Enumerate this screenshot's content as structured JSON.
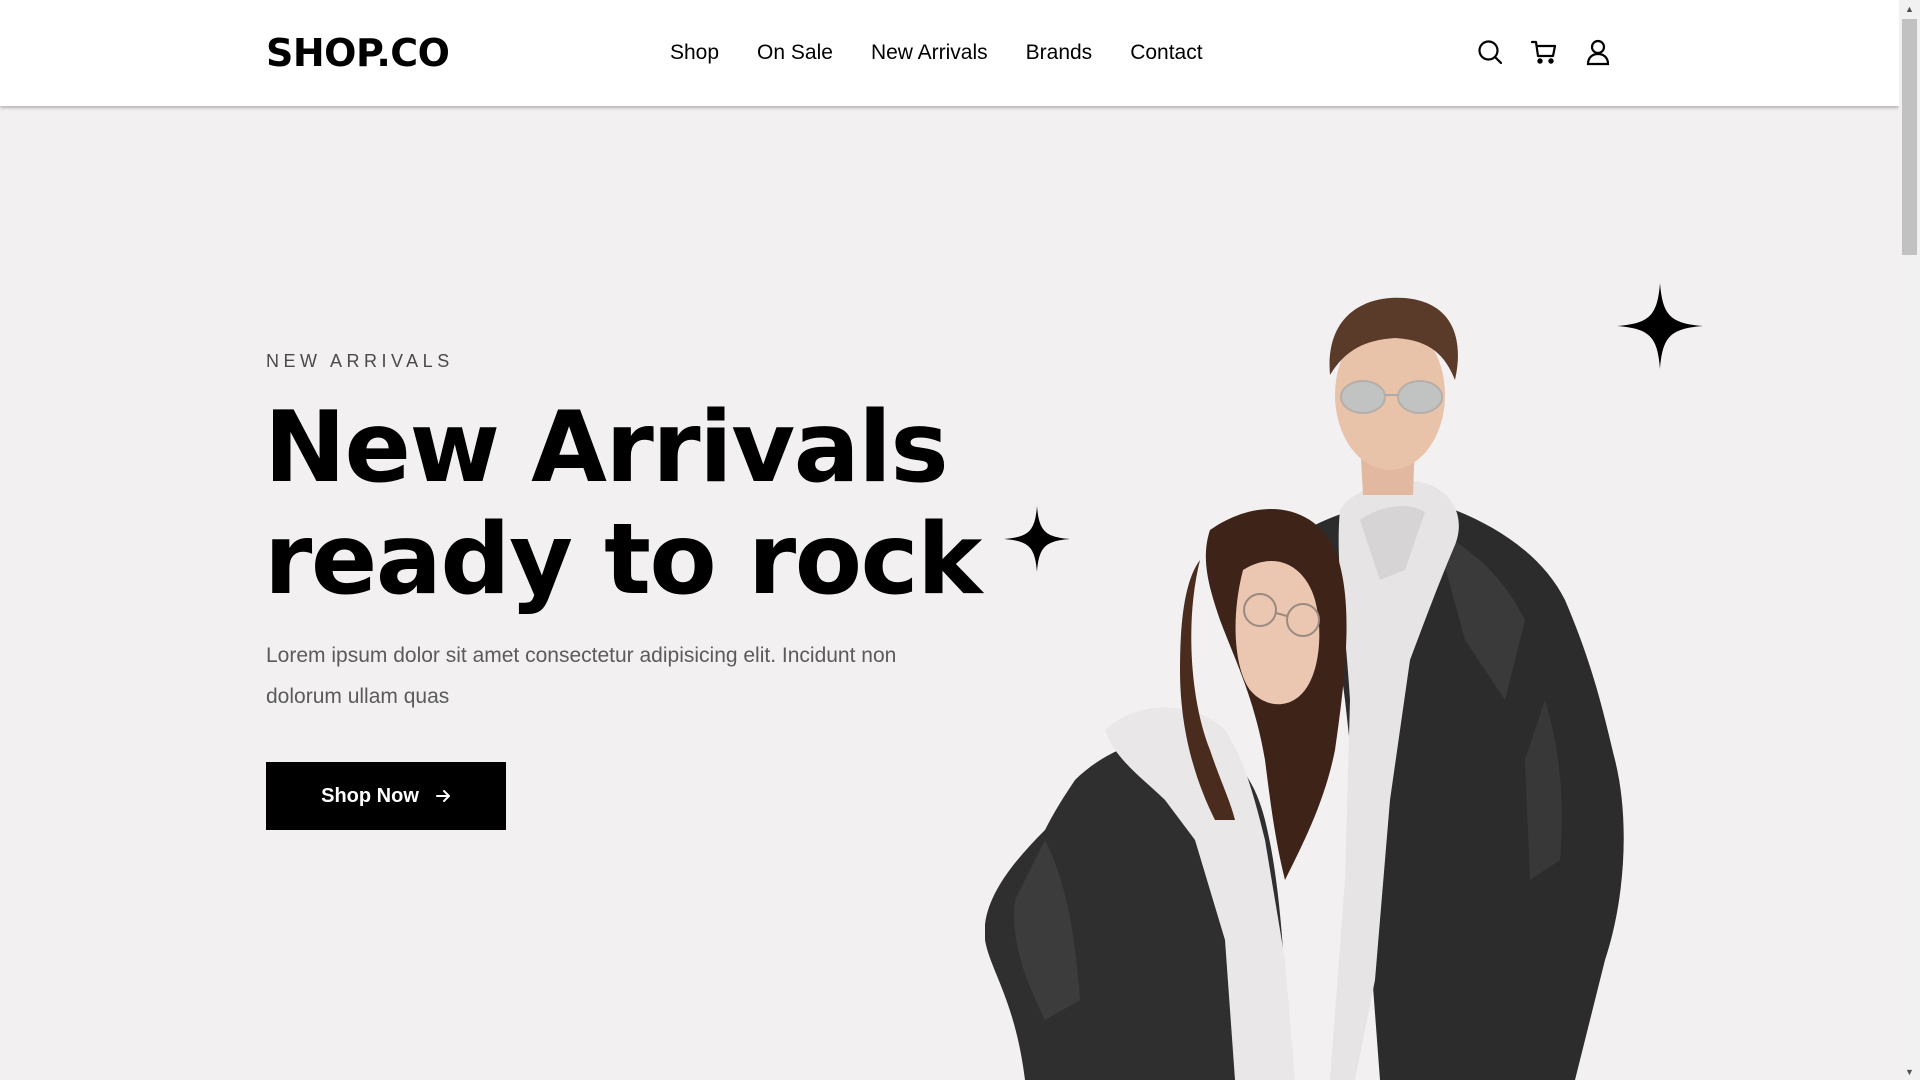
{
  "header": {
    "logo": "SHOP.CO",
    "nav": [
      "Shop",
      "On Sale",
      "New Arrivals",
      "Brands",
      "Contact"
    ],
    "icons": [
      "search-icon",
      "cart-icon",
      "user-icon"
    ]
  },
  "hero": {
    "eyebrow": "NEW ARRIVALS",
    "title_line1": "New Arrivals",
    "title_line2": "ready to rock",
    "description": "Lorem ipsum dolor sit amet consectetur adipisicing elit. Incidunt non dolorum ullam quas",
    "cta_label": "Shop Now",
    "cta_icon": "arrow-right-icon"
  },
  "colors": {
    "background": "#f2f0f1",
    "header": "#ffffff",
    "text": "#000000",
    "muted": "#5b5b5b",
    "button": "#000000",
    "jacket": "#2b2b2b",
    "hoodie": "#e8e6e6"
  }
}
